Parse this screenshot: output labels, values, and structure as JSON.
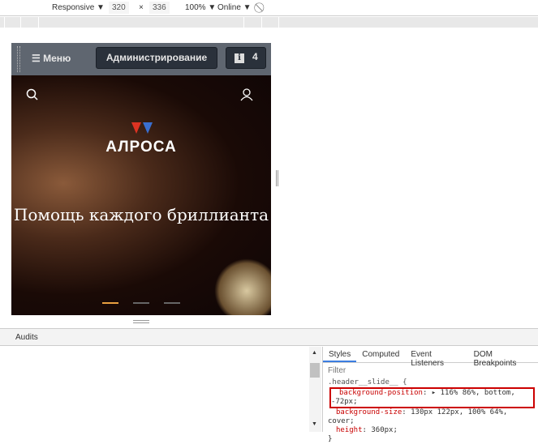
{
  "toolbar": {
    "device": "Responsive ▼",
    "width": "320",
    "times": "×",
    "height": "336",
    "zoom": "100% ▼",
    "network": "Online ▼"
  },
  "admin": {
    "menu": "Меню",
    "admin_label": "Администрирование",
    "info_count": "4"
  },
  "hero": {
    "logo": "АЛРОСА",
    "title": "Помощь каждого бриллианта"
  },
  "drawer": {
    "tab": "Audits"
  },
  "styles": {
    "tabs": [
      "Styles",
      "Computed",
      "Event Listeners",
      "DOM Breakpoints"
    ],
    "filter": "Filter",
    "selector": ".header__slide__ {",
    "lines": [
      {
        "prop": "background-position",
        "value": "116% 86%, bottom, -72px;"
      },
      {
        "prop": "background-size",
        "value": "130px 122px, 100% 64%, cover;"
      },
      {
        "prop": "height",
        "value": "360px;"
      }
    ],
    "close": "}"
  },
  "colors": {
    "highlight": "#cc0000",
    "accent": "#e8a040"
  }
}
